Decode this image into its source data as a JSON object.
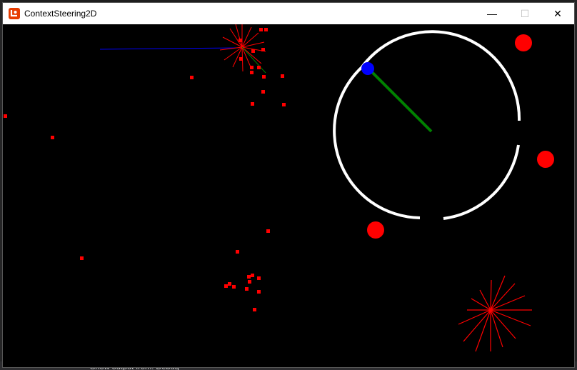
{
  "window": {
    "title": "ContextSteering2D",
    "app_icon": "monogame-icon",
    "controls": {
      "minimize": "—",
      "maximize": "☐",
      "close": "✕"
    }
  },
  "background_ide": {
    "output_label": "Show output from:  Debug"
  },
  "colors": {
    "agent_ray": "#ff0000",
    "player_path": "#0000ff",
    "heading_line": "#008000",
    "ring": "#ffffff",
    "player_dot": "#0000ff",
    "obstacle": "#ff0000",
    "titlebar": "#ffffff",
    "scene_bg": "#000000"
  }
}
